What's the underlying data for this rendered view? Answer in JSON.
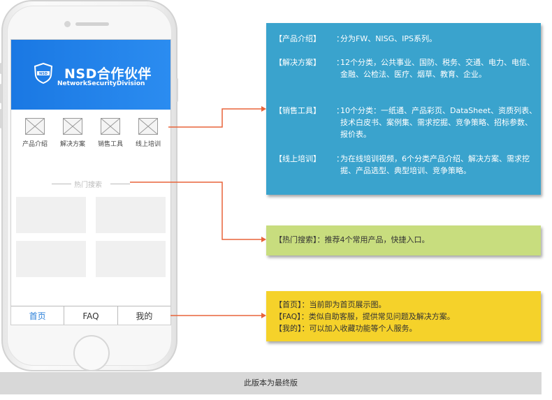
{
  "brand": {
    "title": "NSD合作伙伴",
    "subtitle": "NetworkSecurityDivision",
    "shield_text": "NSD",
    "color": "#1a78e3"
  },
  "menu": [
    {
      "label": "产品介绍",
      "icon": "image-placeholder-icon"
    },
    {
      "label": "解决方案",
      "icon": "image-placeholder-icon"
    },
    {
      "label": "销售工具",
      "icon": "image-placeholder-icon"
    },
    {
      "label": "线上培训",
      "icon": "image-placeholder-icon"
    }
  ],
  "hot_search_label": "热门搜索",
  "tabs": [
    {
      "label": "首页",
      "active": true
    },
    {
      "label": "FAQ",
      "active": false
    },
    {
      "label": "我的",
      "active": false
    }
  ],
  "annotations": {
    "menu_notes": [
      {
        "key": "【产品介绍】",
        "sep": "：",
        "text": "分为FW、NISG、IPS系列。"
      },
      {
        "key": "【解决方案】",
        "sep": "：",
        "text": "12个分类，公共事业、国防、税务、交通、电力、电信、金融、公检法、医疗、烟草、教育、企业。"
      },
      {
        "key": "【销售工具】",
        "sep": "：",
        "text": "10个分类：一纸通、产品彩页、DataSheet、资质列表、技术白皮书、案例集、需求挖掘、竞争策略、招标参数、报价表。"
      },
      {
        "key": "【线上培训】",
        "sep": "：",
        "text": "为在线培训视频，6个分类产品介绍、解决方案、需求挖掘、产品选型、典型培训、竞争策略。"
      }
    ],
    "hot_note": "【热门搜索】：推荐4个常用产品，快捷入口。",
    "tab_notes": [
      "【首页】：当前即为首页展示图。",
      "【FAQ】：类似自助客服，提供常见问题及解决方案。",
      "【我的】：可以加入收藏功能等个人服务。"
    ],
    "colors": {
      "blue": "#3aa3cd",
      "green": "#c8dd7e",
      "yellow": "#f5d22a",
      "connector": "#e8643a"
    }
  },
  "footer": "此版本为最终版"
}
